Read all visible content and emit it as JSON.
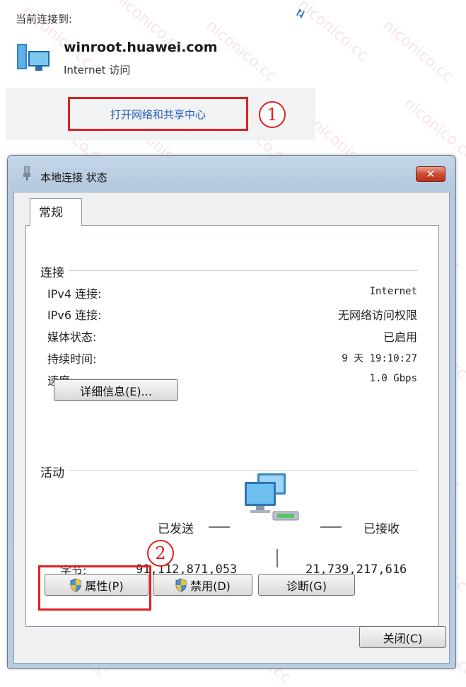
{
  "top": {
    "heading": "当前连接到:",
    "network_name": "winroot.huawei.com",
    "network_status": "Internet 访问",
    "open_center_link": "打开网络和共享中心",
    "annotation_1": "1"
  },
  "dialog": {
    "title": "本地连接 状态",
    "close_glyph": "✕",
    "tab_label": "常规",
    "connection": {
      "section_label": "连接",
      "rows": [
        {
          "label": "IPv4 连接:",
          "value": "Internet"
        },
        {
          "label": "IPv6 连接:",
          "value": "无网络访问权限"
        },
        {
          "label": "媒体状态:",
          "value": "已启用"
        },
        {
          "label": "持续时间:",
          "value": "9 天 19:10:27"
        },
        {
          "label": "速度:",
          "value": "1.0 Gbps"
        }
      ],
      "details_button": "详细信息(E)..."
    },
    "activity": {
      "section_label": "活动",
      "sent_label": "已发送",
      "received_label": "已接收",
      "bytes_label": "字节:",
      "bytes_sent": "91,112,871,053",
      "bytes_received": "21,739,217,616"
    },
    "buttons": {
      "properties": "属性(P)",
      "disable": "禁用(D)",
      "diagnose": "诊断(G)",
      "close": "关闭(C)"
    },
    "annotation_2": "2"
  },
  "watermark": "niconico.cc",
  "colors": {
    "annotation_red": "#e02020",
    "link_blue": "#1f5fb4",
    "title_bar": "#b9cde2",
    "close_button_red": "#c8452f"
  },
  "icons": [
    "refresh-icon",
    "network-computer-icon",
    "network-plug-icon",
    "shield-icon",
    "computers-network-icon"
  ]
}
